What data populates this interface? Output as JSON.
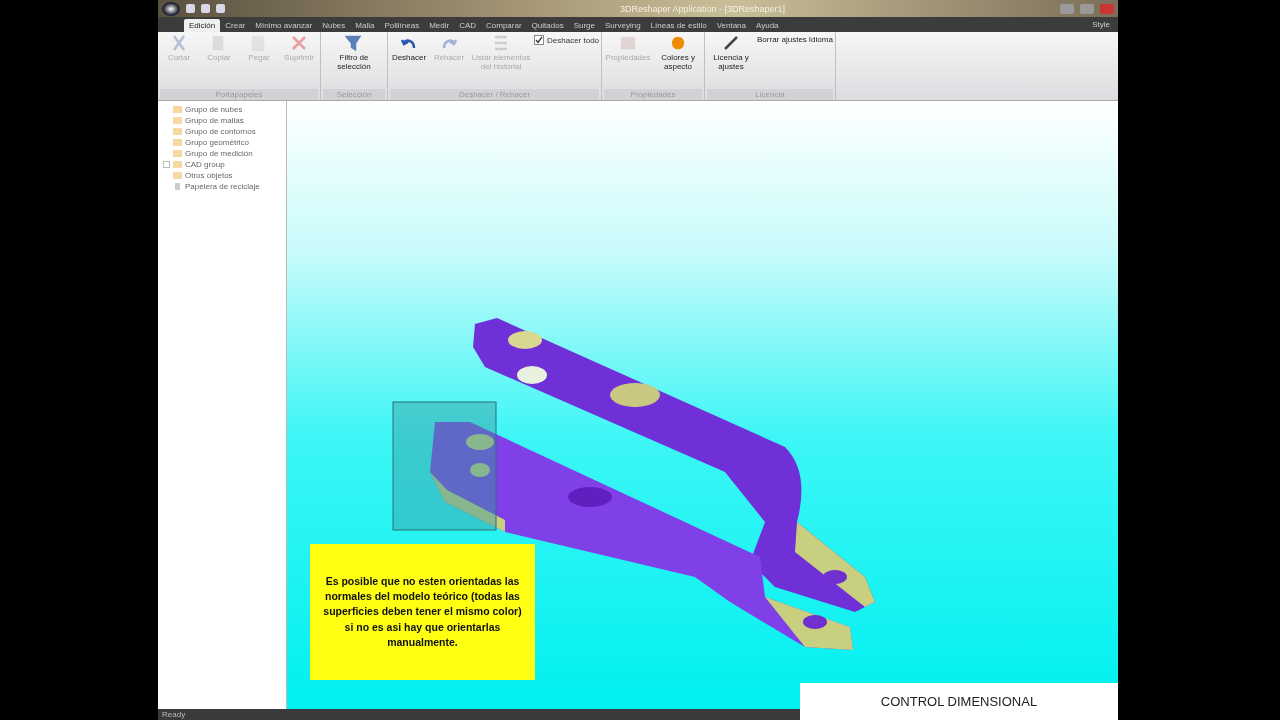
{
  "window": {
    "title": "3DReshaper Application - [3DReshaper1]"
  },
  "menu_tabs": [
    {
      "label": "Edición",
      "selected": true
    },
    {
      "label": "Crear",
      "selected": false
    },
    {
      "label": "Mínimo avanzar",
      "selected": false
    },
    {
      "label": "Nubes",
      "selected": false
    },
    {
      "label": "Malla",
      "selected": false
    },
    {
      "label": "Polilíneas",
      "selected": false
    },
    {
      "label": "Medir",
      "selected": false
    },
    {
      "label": "CAD",
      "selected": false
    },
    {
      "label": "Comparar",
      "selected": false
    },
    {
      "label": "Quitados",
      "selected": false
    },
    {
      "label": "Surge",
      "selected": false
    },
    {
      "label": "Surveying",
      "selected": false
    },
    {
      "label": "Líneas de estilo",
      "selected": false
    },
    {
      "label": "Ventana",
      "selected": false
    },
    {
      "label": "Ayuda",
      "selected": false
    }
  ],
  "style_menu": "Style",
  "ribbon_groups": [
    {
      "label": "Portapapeles",
      "items": [
        {
          "kind": "button",
          "label": "Cortar",
          "disabled": true
        },
        {
          "kind": "button",
          "label": "Copiar",
          "disabled": true
        },
        {
          "kind": "button",
          "label": "Pegar",
          "disabled": true
        },
        {
          "kind": "button",
          "label": "Suprimir",
          "disabled": true
        }
      ]
    },
    {
      "label": "Selección",
      "items": [
        {
          "kind": "button",
          "label": "Filtro de selección",
          "disabled": false
        }
      ]
    },
    {
      "label": "Deshacer / Rehacer",
      "items": [
        {
          "kind": "button",
          "label": "Deshacer",
          "disabled": false
        },
        {
          "kind": "button",
          "label": "Rehacer",
          "disabled": true
        },
        {
          "kind": "button",
          "label": "Listar elementos del historial",
          "disabled": true
        },
        {
          "kind": "checkbox",
          "label": "Deshacer todo",
          "checked": true
        }
      ]
    },
    {
      "label": "Propiedades",
      "items": [
        {
          "kind": "button",
          "label": "Propiedades",
          "disabled": true
        },
        {
          "kind": "button",
          "label": "Colores y aspecto",
          "disabled": false
        }
      ]
    },
    {
      "label": "Licencia",
      "items": [
        {
          "kind": "button",
          "label": "Licencia y ajustes",
          "disabled": false
        },
        {
          "kind": "small",
          "label": "Borrar ajustes"
        },
        {
          "kind": "small",
          "label": "Idioma"
        }
      ]
    }
  ],
  "tree": [
    {
      "label": "Grupo de nubes",
      "kind": "folder"
    },
    {
      "label": "Grupo de mallas",
      "kind": "folder"
    },
    {
      "label": "Grupo de contornos",
      "kind": "folder"
    },
    {
      "label": "Grupo geométrico",
      "kind": "folder"
    },
    {
      "label": "Grupo de medición",
      "kind": "folder"
    },
    {
      "label": "CAD group",
      "kind": "folder",
      "expandable": true
    },
    {
      "label": "Otros objetos",
      "kind": "folder"
    },
    {
      "label": "Papelera de reciclaje",
      "kind": "bin"
    }
  ],
  "note": "Es posible que no esten orientadas las normales del modelo teórico (todas las superficies deben tener el mismo color) si no es asi hay que orientarlas manualmente.",
  "caption": "CONTROL DIMENSIONAL",
  "status_bar": "Ready"
}
